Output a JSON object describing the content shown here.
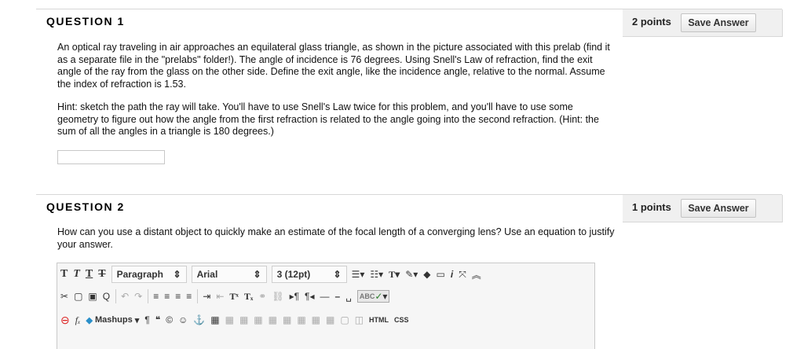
{
  "questions": [
    {
      "title": "QUESTION 1",
      "points": "2 points",
      "save_label": "Save Answer",
      "paragraphs": [
        "An optical ray traveling in air approaches an equilateral glass triangle, as shown in the picture associated with this prelab (find it as a separate file in the \"prelabs\" folder!).  The angle of incidence is 76 degrees.  Using Snell's Law of refraction, find the exit angle of the ray from the glass on the other side.  Define the exit angle, like the incidence angle, relative to the normal.  Assume the index of refraction is 1.53.",
        "Hint: sketch the path the ray will take.  You'll have to use Snell's Law twice for this problem, and you'll have to use some geometry to figure out how the angle from the first refraction is related to the angle going into the second refraction.  (Hint: the sum of all the angles in a triangle is 180 degrees.)"
      ],
      "answer_value": ""
    },
    {
      "title": "QUESTION 2",
      "points": "1 points",
      "save_label": "Save Answer",
      "paragraphs": [
        "How can you use a distant object to quickly make an estimate of the focal length of a converging lens?  Use an equation to justify your answer."
      ]
    }
  ],
  "editor": {
    "block_format": "Paragraph",
    "font_family": "Arial",
    "font_size": "3 (12pt)",
    "mashups_label": "Mashups",
    "html_label": "HTML",
    "css_label": "CSS",
    "spell_label": "ABC"
  }
}
